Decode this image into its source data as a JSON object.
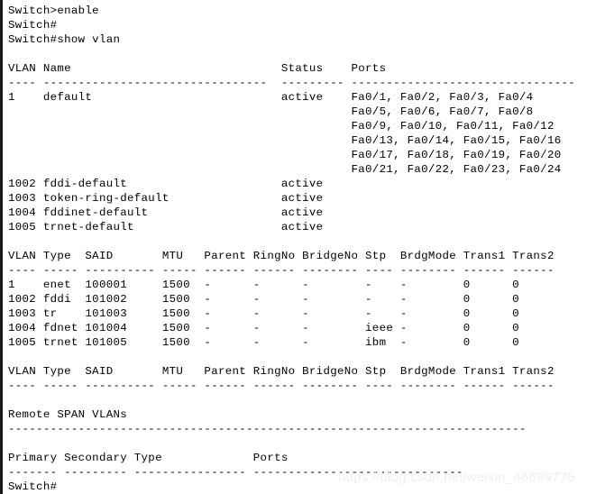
{
  "terminal": {
    "prompt_user": "Switch>",
    "prompt_priv": "Switch#",
    "commands": [
      {
        "prompt": "Switch>",
        "command": "enable"
      },
      {
        "prompt": "Switch#",
        "command": ""
      },
      {
        "prompt": "Switch#",
        "command": "show vlan"
      }
    ],
    "final_prompt": "Switch#",
    "background_color": "#ffffff",
    "text_color": "#000000"
  },
  "vlan_table": {
    "headers": [
      "VLAN",
      "Name",
      "Status",
      "Ports"
    ],
    "separator_widths": [
      4,
      32,
      9,
      32
    ],
    "rows": [
      {
        "vlan": "1",
        "name": "default",
        "status": "active",
        "ports": [
          "Fa0/1, Fa0/2, Fa0/3, Fa0/4",
          "Fa0/5, Fa0/6, Fa0/7, Fa0/8",
          "Fa0/9, Fa0/10, Fa0/11, Fa0/12",
          "Fa0/13, Fa0/14, Fa0/15, Fa0/16",
          "Fa0/17, Fa0/18, Fa0/19, Fa0/20",
          "Fa0/21, Fa0/22, Fa0/23, Fa0/24"
        ]
      },
      {
        "vlan": "1002",
        "name": "fddi-default",
        "status": "active",
        "ports": []
      },
      {
        "vlan": "1003",
        "name": "token-ring-default",
        "status": "active",
        "ports": []
      },
      {
        "vlan": "1004",
        "name": "fddinet-default",
        "status": "active",
        "ports": []
      },
      {
        "vlan": "1005",
        "name": "trnet-default",
        "status": "active",
        "ports": []
      }
    ]
  },
  "said_table": {
    "headers": [
      "VLAN",
      "Type",
      "SAID",
      "MTU",
      "Parent",
      "RingNo",
      "BridgeNo",
      "Stp",
      "BrdgMode",
      "Trans1",
      "Trans2"
    ],
    "separator_widths": [
      4,
      5,
      10,
      5,
      6,
      6,
      8,
      4,
      8,
      6,
      6
    ],
    "rows": [
      {
        "vlan": "1",
        "type": "enet",
        "said": "100001",
        "mtu": "1500",
        "parent": "-",
        "ringno": "-",
        "bridgeno": "-",
        "stp": "-",
        "brdgmode": "-",
        "trans1": "0",
        "trans2": "0"
      },
      {
        "vlan": "1002",
        "type": "fddi",
        "said": "101002",
        "mtu": "1500",
        "parent": "-",
        "ringno": "-",
        "bridgeno": "-",
        "stp": "-",
        "brdgmode": "-",
        "trans1": "0",
        "trans2": "0"
      },
      {
        "vlan": "1003",
        "type": "tr",
        "said": "101003",
        "mtu": "1500",
        "parent": "-",
        "ringno": "-",
        "bridgeno": "-",
        "stp": "-",
        "brdgmode": "-",
        "trans1": "0",
        "trans2": "0"
      },
      {
        "vlan": "1004",
        "type": "fdnet",
        "said": "101004",
        "mtu": "1500",
        "parent": "-",
        "ringno": "-",
        "bridgeno": "-",
        "stp": "ieee",
        "brdgmode": "-",
        "trans1": "0",
        "trans2": "0"
      },
      {
        "vlan": "1005",
        "type": "trnet",
        "said": "101005",
        "mtu": "1500",
        "parent": "-",
        "ringno": "-",
        "bridgeno": "-",
        "stp": "ibm",
        "brdgmode": "-",
        "trans1": "0",
        "trans2": "0"
      }
    ]
  },
  "said_table_empty": {
    "headers": [
      "VLAN",
      "Type",
      "SAID",
      "MTU",
      "Parent",
      "RingNo",
      "BridgeNo",
      "Stp",
      "BrdgMode",
      "Trans1",
      "Trans2"
    ],
    "rows": []
  },
  "remote_span": {
    "title": "Remote SPAN VLANs",
    "rule_width": 74,
    "vlans": []
  },
  "private_vlan_table": {
    "headers": [
      "Primary",
      "Secondary",
      "Type",
      "Ports"
    ],
    "separator_widths": [
      7,
      9,
      16,
      30
    ],
    "rows": []
  },
  "watermark": {
    "text": "https://blog.csdn.net/weixin_46699775",
    "color": "#efefef"
  }
}
